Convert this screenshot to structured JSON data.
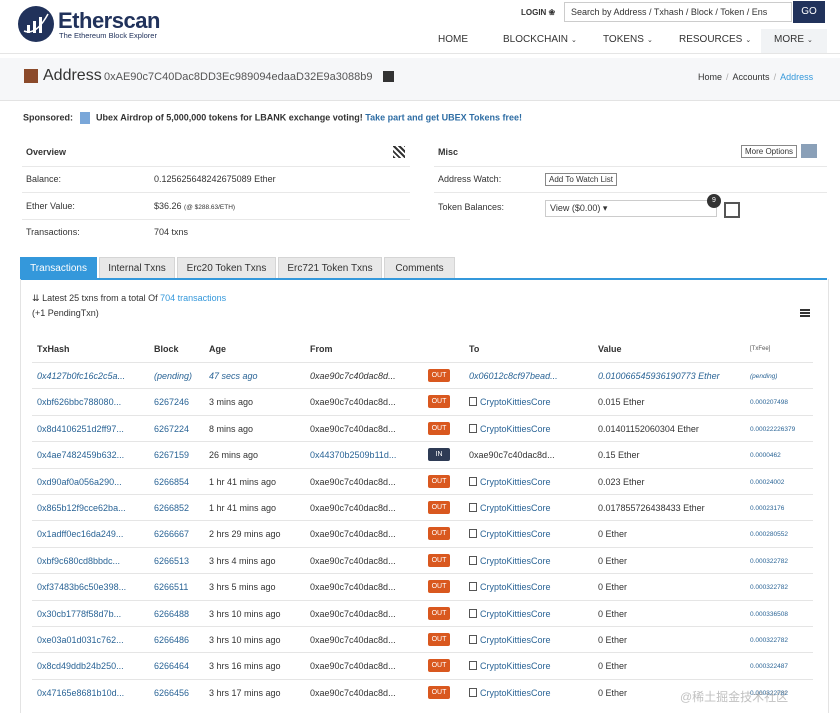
{
  "header": {
    "brand": "Etherscan",
    "brand_sub": "The Ethereum Block Explorer",
    "login": "LOGIN ❀",
    "search_placeholder": "Search by Address / Txhash / Block / Token / Ens",
    "go": "GO",
    "nav": [
      {
        "label": "HOME",
        "chev": ""
      },
      {
        "label": "BLOCKCHAIN",
        "chev": "⌄"
      },
      {
        "label": "TOKENS",
        "chev": "⌄"
      },
      {
        "label": "RESOURCES",
        "chev": "⌄"
      },
      {
        "label": "MORE",
        "chev": "⌄"
      }
    ]
  },
  "address": {
    "title": "Address",
    "hash": "0xAE90c7C40Dac8DD3Ec989094edaaD32E9a3088b9",
    "breadcrumb": [
      "Home",
      "Accounts",
      "Address"
    ]
  },
  "sponsored": {
    "label": "Sponsored:",
    "text": "Ubex Airdrop of 5,000,000 tokens for LBANK exchange voting!",
    "cta": "Take part and get UBEX Tokens free!"
  },
  "overview": {
    "title": "Overview",
    "balance_label": "Balance:",
    "balance": "0.125625648242675089 Ether",
    "ether_value_label": "Ether Value:",
    "ether_value": "$36.26",
    "ether_rate": "(@ $288.63/ETH)",
    "transactions_label": "Transactions:",
    "transactions": "704 txns"
  },
  "misc": {
    "title": "Misc",
    "more_options": "More Options",
    "watch_label": "Address Watch:",
    "watch_button": "Add To Watch List",
    "token_label": "Token Balances:",
    "token_select": "View ($0.00) ▾",
    "token_count": "9"
  },
  "tabs": [
    "Transactions",
    "Internal Txns",
    "Erc20 Token Txns",
    "Erc721 Token Txns",
    "Comments"
  ],
  "summary": {
    "prefix": "Latest 25 txns from a total Of",
    "link": "704 transactions",
    "pending": "(+1 PendingTxn)"
  },
  "table": {
    "headers": [
      "TxHash",
      "Block",
      "Age",
      "From",
      "To",
      "Value",
      "[TxFee]"
    ],
    "rows": [
      {
        "hash": "0x4127b0fc16c2c5a...",
        "block": "(pending)",
        "age": "47 secs ago",
        "from": "0xae90c7c40dac8d...",
        "dir": "OUT",
        "to": "0x06012c8cf97bead...",
        "contract": false,
        "value": "0.010066545936190773 Ether",
        "fee": "(pending)"
      },
      {
        "hash": "0xbf626bbc788080...",
        "block": "6267246",
        "age": "3 mins ago",
        "from": "0xae90c7c40dac8d...",
        "dir": "OUT",
        "to": "CryptoKittiesCore",
        "contract": true,
        "value": "0.015 Ether",
        "fee": "0.000207498"
      },
      {
        "hash": "0x8d4106251d2ff97...",
        "block": "6267224",
        "age": "8 mins ago",
        "from": "0xae90c7c40dac8d...",
        "dir": "OUT",
        "to": "CryptoKittiesCore",
        "contract": true,
        "value": "0.01401152060304 Ether",
        "fee": "0.00022226379"
      },
      {
        "hash": "0x4ae7482459b632...",
        "block": "6267159",
        "age": "26 mins ago",
        "from": "0x44370b2509b11d...",
        "dir": "IN",
        "to": "0xae90c7c40dac8d...",
        "contract": false,
        "value": "0.15 Ether",
        "fee": "0.0000462"
      },
      {
        "hash": "0xd90af0a056a290...",
        "block": "6266854",
        "age": "1 hr 41 mins ago",
        "from": "0xae90c7c40dac8d...",
        "dir": "OUT",
        "to": "CryptoKittiesCore",
        "contract": true,
        "value": "0.023 Ether",
        "fee": "0.00024002"
      },
      {
        "hash": "0x865b12f9cce62ba...",
        "block": "6266852",
        "age": "1 hr 41 mins ago",
        "from": "0xae90c7c40dac8d...",
        "dir": "OUT",
        "to": "CryptoKittiesCore",
        "contract": true,
        "value": "0.017855726438433 Ether",
        "fee": "0.00023176"
      },
      {
        "hash": "0x1adff0ec16da249...",
        "block": "6266667",
        "age": "2 hrs 29 mins ago",
        "from": "0xae90c7c40dac8d...",
        "dir": "OUT",
        "to": "CryptoKittiesCore",
        "contract": true,
        "value": "0 Ether",
        "fee": "0.000280552"
      },
      {
        "hash": "0xbf9c680cd8bbdc...",
        "block": "6266513",
        "age": "3 hrs 4 mins ago",
        "from": "0xae90c7c40dac8d...",
        "dir": "OUT",
        "to": "CryptoKittiesCore",
        "contract": true,
        "value": "0 Ether",
        "fee": "0.000322782"
      },
      {
        "hash": "0xf37483b6c50e398...",
        "block": "6266511",
        "age": "3 hrs 5 mins ago",
        "from": "0xae90c7c40dac8d...",
        "dir": "OUT",
        "to": "CryptoKittiesCore",
        "contract": true,
        "value": "0 Ether",
        "fee": "0.000322782"
      },
      {
        "hash": "0x30cb1778f58d7b...",
        "block": "6266488",
        "age": "3 hrs 10 mins ago",
        "from": "0xae90c7c40dac8d...",
        "dir": "OUT",
        "to": "CryptoKittiesCore",
        "contract": true,
        "value": "0 Ether",
        "fee": "0.000336508"
      },
      {
        "hash": "0xe03a01d031c762...",
        "block": "6266486",
        "age": "3 hrs 10 mins ago",
        "from": "0xae90c7c40dac8d...",
        "dir": "OUT",
        "to": "CryptoKittiesCore",
        "contract": true,
        "value": "0 Ether",
        "fee": "0.000322782"
      },
      {
        "hash": "0x8cd49ddb24b250...",
        "block": "6266464",
        "age": "3 hrs 16 mins ago",
        "from": "0xae90c7c40dac8d...",
        "dir": "OUT",
        "to": "CryptoKittiesCore",
        "contract": true,
        "value": "0 Ether",
        "fee": "0.000322487"
      },
      {
        "hash": "0x47165e8681b10d...",
        "block": "6266456",
        "age": "3 hrs 17 mins ago",
        "from": "0xae90c7c40dac8d...",
        "dir": "OUT",
        "to": "CryptoKittiesCore",
        "contract": true,
        "value": "0 Ether",
        "fee": "0.000322782"
      }
    ]
  },
  "watermark": "@稀土掘金技术社区"
}
